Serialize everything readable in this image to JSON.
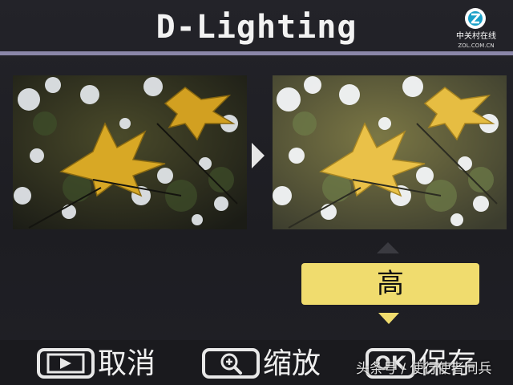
{
  "header": {
    "title": "D-Lighting",
    "logo_name": "中关村在线",
    "logo_domain": "ZOL.COM.CN"
  },
  "preview": {
    "original_image": "autumn-leaf-photo",
    "processed_image": "autumn-leaf-photo-brightened",
    "arrow_icon": "triangle-right-icon"
  },
  "level": {
    "value": "高"
  },
  "footer": {
    "cancel_label": "取消",
    "zoom_label": "缩放",
    "save_label": "保存",
    "ok_key": "OK"
  },
  "watermark": "头条号 / 使行使者同兵",
  "colors": {
    "title_rule": "#8a86a8",
    "level_highlight": "#f0dc6e",
    "background": "#1f1f24"
  }
}
